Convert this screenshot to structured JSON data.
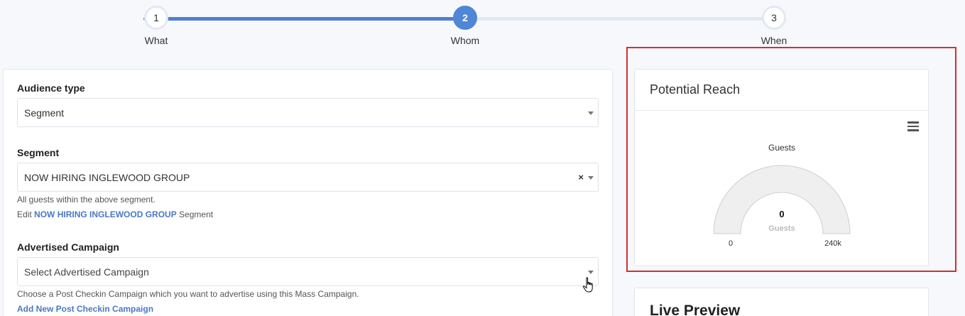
{
  "stepper": {
    "steps": [
      {
        "number": "1",
        "label": "What",
        "state": "done"
      },
      {
        "number": "2",
        "label": "Whom",
        "state": "active"
      },
      {
        "number": "3",
        "label": "When",
        "state": "todo"
      }
    ]
  },
  "form": {
    "audience_type": {
      "label": "Audience type",
      "value": "Segment"
    },
    "segment": {
      "label": "Segment",
      "value": "NOW HIRING INGLEWOOD GROUP",
      "clear": "×",
      "help": "All guests within the above segment.",
      "edit_prefix": "Edit",
      "edit_link": "NOW HIRING INGLEWOOD GROUP",
      "edit_suffix": "Segment"
    },
    "advertised_campaign": {
      "label": "Advertised Campaign",
      "placeholder": "Select Advertised Campaign",
      "help": "Choose a Post Checkin Campaign which you want to advertise using this Mass Campaign.",
      "add_link": "Add New Post Checkin Campaign"
    }
  },
  "reach": {
    "title": "Potential Reach",
    "menu_icon": "hamburger-menu-icon",
    "chart_data": {
      "type": "gauge",
      "title": "Guests",
      "value": 0,
      "value_label": "0",
      "unit_label": "Guests",
      "min_label": "0",
      "max_label": "240k",
      "range": [
        0,
        240000
      ]
    }
  },
  "preview": {
    "title": "Live Preview"
  },
  "colors": {
    "accent": "#4f86d6",
    "highlight": "#d32f2f",
    "link": "#4a78c4"
  }
}
